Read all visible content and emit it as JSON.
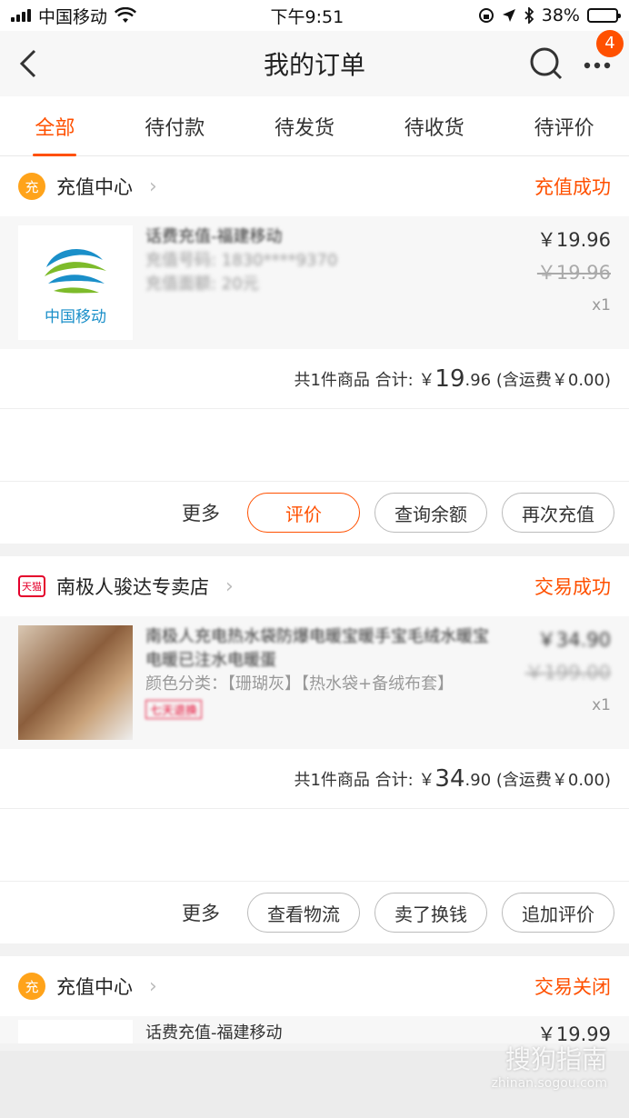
{
  "status_bar": {
    "carrier": "中国移动",
    "time": "下午9:51",
    "battery": "38%",
    "battery_level": 0.38
  },
  "nav": {
    "title": "我的订单",
    "badge_count": "4"
  },
  "tabs": [
    {
      "label": "全部",
      "active": true
    },
    {
      "label": "待付款",
      "active": false
    },
    {
      "label": "待发货",
      "active": false
    },
    {
      "label": "待收货",
      "active": false
    },
    {
      "label": "待评价",
      "active": false
    }
  ],
  "orders": [
    {
      "shop_icon": "充",
      "shop": "充值中心",
      "status": "充值成功",
      "thumb_caption": "中国移动",
      "title": "话费充值-福建移动",
      "sub1": "充值号码: 1830****9370",
      "sub2": "充值面额: 20元",
      "price": "￥19.96",
      "orig_price": "￥19.96",
      "qty": "x1",
      "summary_prefix": "共1件商品 合计: ￥",
      "summary_big": "19",
      "summary_suffix": ".96 (含运费￥0.00)",
      "more": "更多",
      "buttons": [
        "评价",
        "查询余额",
        "再次充值"
      ]
    },
    {
      "shop_icon": "天猫",
      "shop": "南极人骏达专卖店",
      "status": "交易成功",
      "title": "南极人充电热水袋防爆电暖宝暖手宝毛绒水暖宝电暖已注水电暖蛋",
      "sub1": "颜色分类：【珊瑚灰】【热水袋+备绒布套】",
      "tag": "七天退换",
      "price": "￥34.90",
      "orig_price": "￥199.00",
      "qty": "x1",
      "summary_prefix": "共1件商品 合计: ￥",
      "summary_big": "34",
      "summary_suffix": ".90 (含运费￥0.00)",
      "more": "更多",
      "buttons": [
        "查看物流",
        "卖了换钱",
        "追加评价"
      ]
    },
    {
      "shop_icon": "充",
      "shop": "充值中心",
      "status": "交易关闭",
      "title": "话费充值-福建移动",
      "price": "￥19.99"
    }
  ],
  "watermark": {
    "main": "搜狗指南",
    "sub": "zhinan.sogou.com"
  },
  "colors": {
    "accent": "#ff5000",
    "tmall": "#e4002b",
    "cmcc_blue": "#1a8fc9",
    "cmcc_green": "#7dbb2a"
  }
}
